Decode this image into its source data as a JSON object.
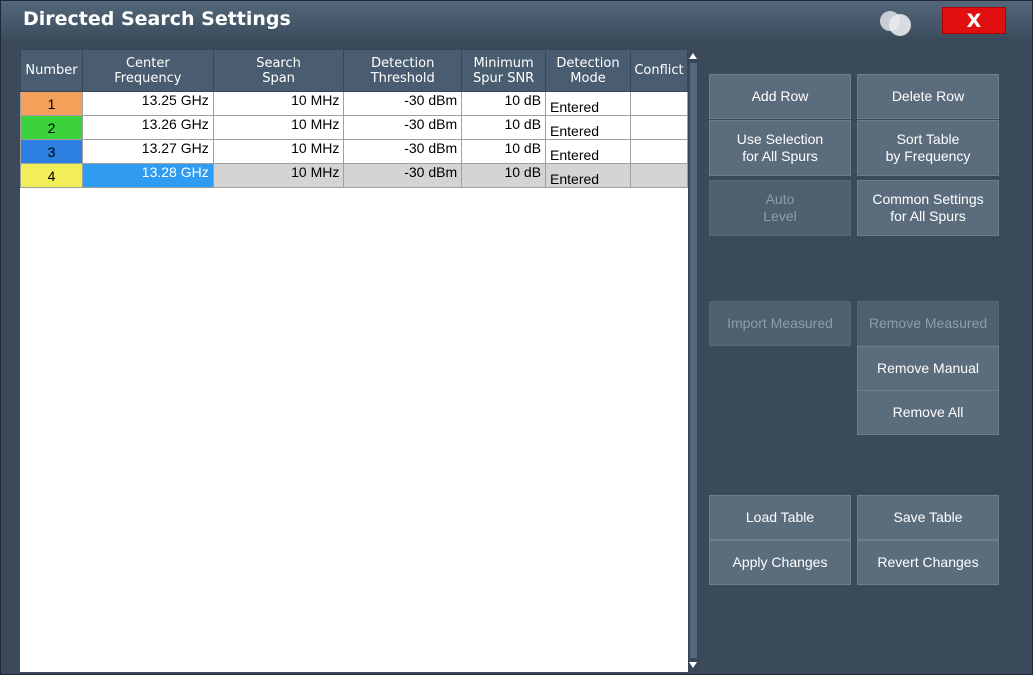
{
  "dialog": {
    "title": "Directed Search Settings",
    "close_label": "X"
  },
  "table": {
    "headers": [
      "Number",
      "Center\nFrequency",
      "Search\nSpan",
      "Detection\nThreshold",
      "Minimum\nSpur SNR",
      "Detection\nMode",
      "Conflict"
    ],
    "rows": [
      {
        "number": "1",
        "center": "13.25 GHz",
        "span": "10 MHz",
        "threshold": "-30 dBm",
        "snr": "10 dB",
        "mode": "Entered",
        "conflict": "",
        "color": "#f4a05a"
      },
      {
        "number": "2",
        "center": "13.26 GHz",
        "span": "10 MHz",
        "threshold": "-30 dBm",
        "snr": "10 dB",
        "mode": "Entered",
        "conflict": "",
        "color": "#3cd23c"
      },
      {
        "number": "3",
        "center": "13.27 GHz",
        "span": "10 MHz",
        "threshold": "-30 dBm",
        "snr": "10 dB",
        "mode": "Entered",
        "conflict": "",
        "color": "#2d7fe0"
      },
      {
        "number": "4",
        "center": "13.28 GHz",
        "span": "10 MHz",
        "threshold": "-30 dBm",
        "snr": "10 dB",
        "mode": "Entered",
        "conflict": "",
        "color": "#f2ee5a"
      }
    ]
  },
  "buttons": {
    "add_row": "Add Row",
    "delete_row": "Delete Row",
    "use_selection": "Use Selection\nfor All Spurs",
    "sort_table": "Sort Table\nby Frequency",
    "auto_level": "Auto\nLevel",
    "common_settings": "Common Settings\nfor All Spurs",
    "import_measured": "Import Measured",
    "remove_measured": "Remove Measured",
    "remove_manual": "Remove Manual",
    "remove_all": "Remove All",
    "load_table": "Load Table",
    "save_table": "Save Table",
    "apply_changes": "Apply Changes",
    "revert_changes": "Revert Changes"
  }
}
